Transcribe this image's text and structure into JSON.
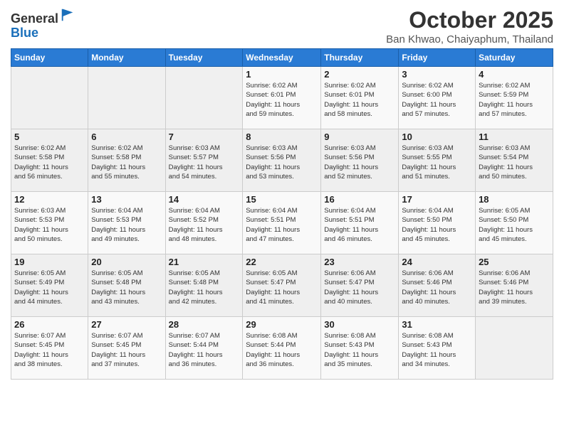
{
  "header": {
    "logo_general": "General",
    "logo_blue": "Blue",
    "title": "October 2025",
    "subtitle": "Ban Khwao, Chaiyaphum, Thailand"
  },
  "weekdays": [
    "Sunday",
    "Monday",
    "Tuesday",
    "Wednesday",
    "Thursday",
    "Friday",
    "Saturday"
  ],
  "weeks": [
    [
      {
        "day": "",
        "info": ""
      },
      {
        "day": "",
        "info": ""
      },
      {
        "day": "",
        "info": ""
      },
      {
        "day": "1",
        "info": "Sunrise: 6:02 AM\nSunset: 6:01 PM\nDaylight: 11 hours\nand 59 minutes."
      },
      {
        "day": "2",
        "info": "Sunrise: 6:02 AM\nSunset: 6:01 PM\nDaylight: 11 hours\nand 58 minutes."
      },
      {
        "day": "3",
        "info": "Sunrise: 6:02 AM\nSunset: 6:00 PM\nDaylight: 11 hours\nand 57 minutes."
      },
      {
        "day": "4",
        "info": "Sunrise: 6:02 AM\nSunset: 5:59 PM\nDaylight: 11 hours\nand 57 minutes."
      }
    ],
    [
      {
        "day": "5",
        "info": "Sunrise: 6:02 AM\nSunset: 5:58 PM\nDaylight: 11 hours\nand 56 minutes."
      },
      {
        "day": "6",
        "info": "Sunrise: 6:02 AM\nSunset: 5:58 PM\nDaylight: 11 hours\nand 55 minutes."
      },
      {
        "day": "7",
        "info": "Sunrise: 6:03 AM\nSunset: 5:57 PM\nDaylight: 11 hours\nand 54 minutes."
      },
      {
        "day": "8",
        "info": "Sunrise: 6:03 AM\nSunset: 5:56 PM\nDaylight: 11 hours\nand 53 minutes."
      },
      {
        "day": "9",
        "info": "Sunrise: 6:03 AM\nSunset: 5:56 PM\nDaylight: 11 hours\nand 52 minutes."
      },
      {
        "day": "10",
        "info": "Sunrise: 6:03 AM\nSunset: 5:55 PM\nDaylight: 11 hours\nand 51 minutes."
      },
      {
        "day": "11",
        "info": "Sunrise: 6:03 AM\nSunset: 5:54 PM\nDaylight: 11 hours\nand 50 minutes."
      }
    ],
    [
      {
        "day": "12",
        "info": "Sunrise: 6:03 AM\nSunset: 5:53 PM\nDaylight: 11 hours\nand 50 minutes."
      },
      {
        "day": "13",
        "info": "Sunrise: 6:04 AM\nSunset: 5:53 PM\nDaylight: 11 hours\nand 49 minutes."
      },
      {
        "day": "14",
        "info": "Sunrise: 6:04 AM\nSunset: 5:52 PM\nDaylight: 11 hours\nand 48 minutes."
      },
      {
        "day": "15",
        "info": "Sunrise: 6:04 AM\nSunset: 5:51 PM\nDaylight: 11 hours\nand 47 minutes."
      },
      {
        "day": "16",
        "info": "Sunrise: 6:04 AM\nSunset: 5:51 PM\nDaylight: 11 hours\nand 46 minutes."
      },
      {
        "day": "17",
        "info": "Sunrise: 6:04 AM\nSunset: 5:50 PM\nDaylight: 11 hours\nand 45 minutes."
      },
      {
        "day": "18",
        "info": "Sunrise: 6:05 AM\nSunset: 5:50 PM\nDaylight: 11 hours\nand 45 minutes."
      }
    ],
    [
      {
        "day": "19",
        "info": "Sunrise: 6:05 AM\nSunset: 5:49 PM\nDaylight: 11 hours\nand 44 minutes."
      },
      {
        "day": "20",
        "info": "Sunrise: 6:05 AM\nSunset: 5:48 PM\nDaylight: 11 hours\nand 43 minutes."
      },
      {
        "day": "21",
        "info": "Sunrise: 6:05 AM\nSunset: 5:48 PM\nDaylight: 11 hours\nand 42 minutes."
      },
      {
        "day": "22",
        "info": "Sunrise: 6:05 AM\nSunset: 5:47 PM\nDaylight: 11 hours\nand 41 minutes."
      },
      {
        "day": "23",
        "info": "Sunrise: 6:06 AM\nSunset: 5:47 PM\nDaylight: 11 hours\nand 40 minutes."
      },
      {
        "day": "24",
        "info": "Sunrise: 6:06 AM\nSunset: 5:46 PM\nDaylight: 11 hours\nand 40 minutes."
      },
      {
        "day": "25",
        "info": "Sunrise: 6:06 AM\nSunset: 5:46 PM\nDaylight: 11 hours\nand 39 minutes."
      }
    ],
    [
      {
        "day": "26",
        "info": "Sunrise: 6:07 AM\nSunset: 5:45 PM\nDaylight: 11 hours\nand 38 minutes."
      },
      {
        "day": "27",
        "info": "Sunrise: 6:07 AM\nSunset: 5:45 PM\nDaylight: 11 hours\nand 37 minutes."
      },
      {
        "day": "28",
        "info": "Sunrise: 6:07 AM\nSunset: 5:44 PM\nDaylight: 11 hours\nand 36 minutes."
      },
      {
        "day": "29",
        "info": "Sunrise: 6:08 AM\nSunset: 5:44 PM\nDaylight: 11 hours\nand 36 minutes."
      },
      {
        "day": "30",
        "info": "Sunrise: 6:08 AM\nSunset: 5:43 PM\nDaylight: 11 hours\nand 35 minutes."
      },
      {
        "day": "31",
        "info": "Sunrise: 6:08 AM\nSunset: 5:43 PM\nDaylight: 11 hours\nand 34 minutes."
      },
      {
        "day": "",
        "info": ""
      }
    ]
  ]
}
